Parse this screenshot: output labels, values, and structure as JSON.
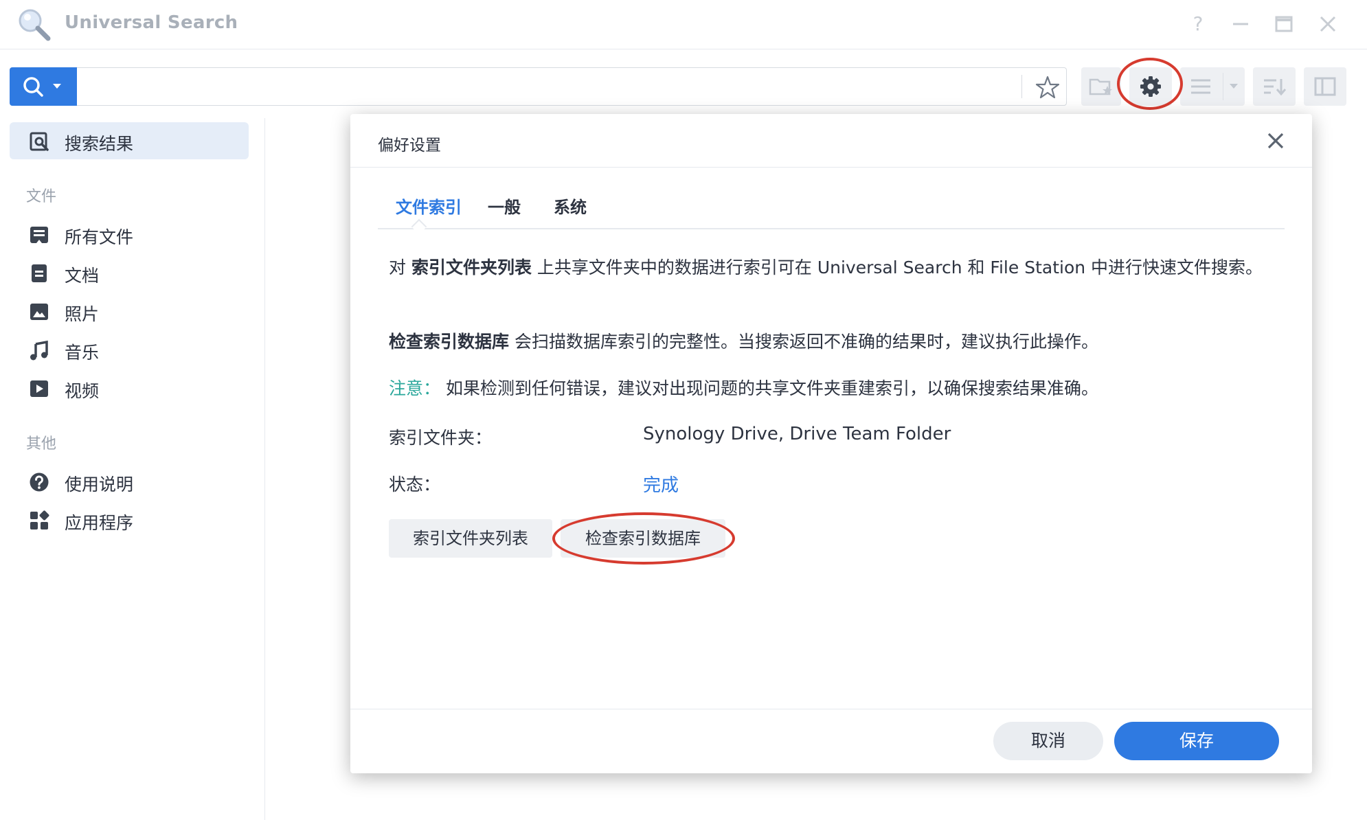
{
  "window": {
    "title": "Universal Search",
    "help_glyph": "?"
  },
  "search": {
    "value": "",
    "placeholder": ""
  },
  "sidebar": {
    "active_item": "搜索结果",
    "section_files": "文件",
    "files_items": [
      "所有文件",
      "文档",
      "照片",
      "音乐",
      "视频"
    ],
    "section_other": "其他",
    "other_items": [
      "使用说明",
      "应用程序"
    ]
  },
  "dialog": {
    "title": "偏好设置",
    "tabs": [
      "文件索引",
      "一般",
      "系统"
    ],
    "active_tab": "文件索引",
    "para1": {
      "prefix": "对 ",
      "bold": "索引文件夹列表",
      "suffix": " 上共享文件夹中的数据进行索引可在 Universal Search 和 File Station 中进行快速文件搜索。"
    },
    "para2": {
      "bold": "检查索引数据库",
      "suffix": " 会扫描数据库索引的完整性。当搜索返回不准确的结果时，建议执行此操作。"
    },
    "note": {
      "label": "注意：",
      "text": "如果检测到任何错误，建议对出现问题的共享文件夹重建索引，以确保搜索结果准确。"
    },
    "fields": {
      "index_folder_label": "索引文件夹：",
      "index_folder_value": "Synology Drive, Drive Team Folder",
      "status_label": "状态：",
      "status_value": "完成"
    },
    "buttons": {
      "folder_list": "索引文件夹列表",
      "check_db": "检查索引数据库",
      "cancel": "取消",
      "save": "保存"
    }
  },
  "colors": {
    "accent": "#2f7ae1",
    "note": "#2aa79b",
    "annotation": "#d63b2f"
  },
  "icons": {
    "toolbar": [
      "search-icon",
      "star-icon",
      "folder-star-icon",
      "gear-icon",
      "list-icon",
      "sort-icon",
      "panel-icon"
    ],
    "window": [
      "help-icon",
      "minimize-icon",
      "maximize-icon",
      "close-icon"
    ]
  }
}
